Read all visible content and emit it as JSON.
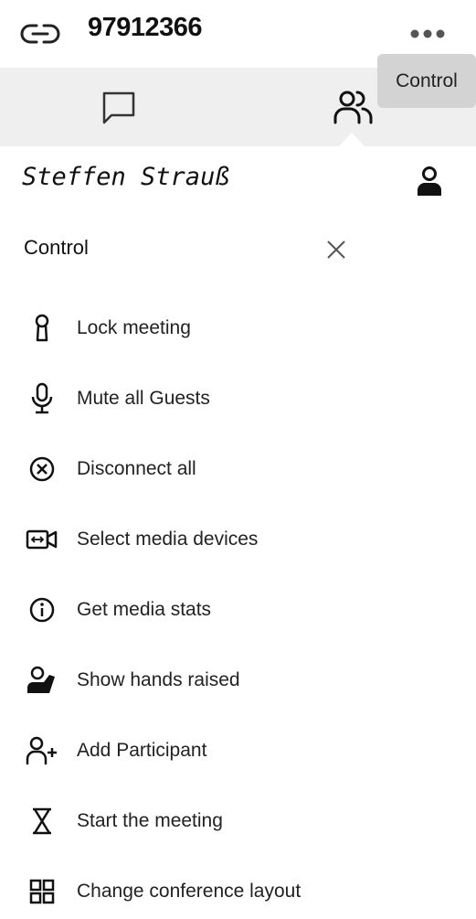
{
  "header": {
    "meeting_id": "97912366"
  },
  "tooltip": {
    "text": "Control"
  },
  "user": {
    "name": "Steffen Strauß"
  },
  "panel": {
    "title": "Control"
  },
  "menu": {
    "items": [
      {
        "label": "Lock meeting",
        "icon": "keyhole-icon"
      },
      {
        "label": "Mute all Guests",
        "icon": "microphone-icon"
      },
      {
        "label": "Disconnect all",
        "icon": "circle-x-icon"
      },
      {
        "label": "Select media devices",
        "icon": "camera-switch-icon"
      },
      {
        "label": "Get media stats",
        "icon": "info-circle-icon"
      },
      {
        "label": "Show hands raised",
        "icon": "raised-hand-icon"
      },
      {
        "label": "Add Participant",
        "icon": "add-person-icon"
      },
      {
        "label": "Start the meeting",
        "icon": "hourglass-icon"
      },
      {
        "label": "Change conference layout",
        "icon": "grid-layout-icon"
      }
    ]
  },
  "colors": {
    "background": "#ffffff",
    "tabbar": "#efefef",
    "tooltip": "#d3d3d3",
    "text": "#111111"
  }
}
